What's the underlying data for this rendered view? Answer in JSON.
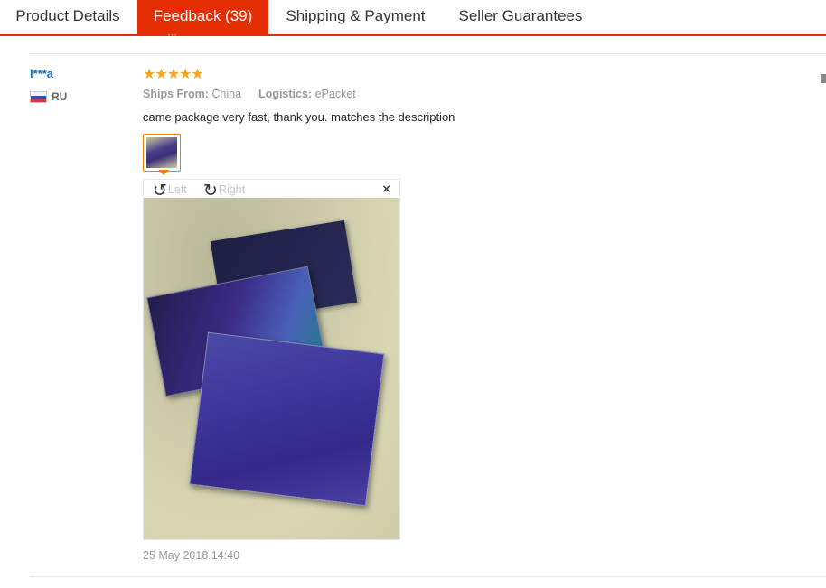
{
  "tabs": [
    {
      "label": "Product Details"
    },
    {
      "label": "Feedback (39)"
    },
    {
      "label": "Shipping & Payment"
    },
    {
      "label": "Seller Guarantees"
    }
  ],
  "review": {
    "user": "l***a",
    "country": "RU",
    "stars": "★★★★★",
    "rating": 5,
    "ships_from_label": "Ships From:",
    "ships_from_value": "China",
    "logistics_label": "Logistics:",
    "logistics_value": "ePacket",
    "comment": "came package very fast, thank you. matches the description",
    "date": "25 May 2018 14:40"
  },
  "viewer": {
    "rotate_left_label": "Left",
    "rotate_right_label": "Right",
    "close_icon": "×",
    "rotate_left_icon": "↺",
    "rotate_right_icon": "↻"
  },
  "colors": {
    "accent": "#e62e04",
    "star": "#f5a623",
    "username": "#0d6cbf",
    "thumb_border": "#f08200"
  }
}
